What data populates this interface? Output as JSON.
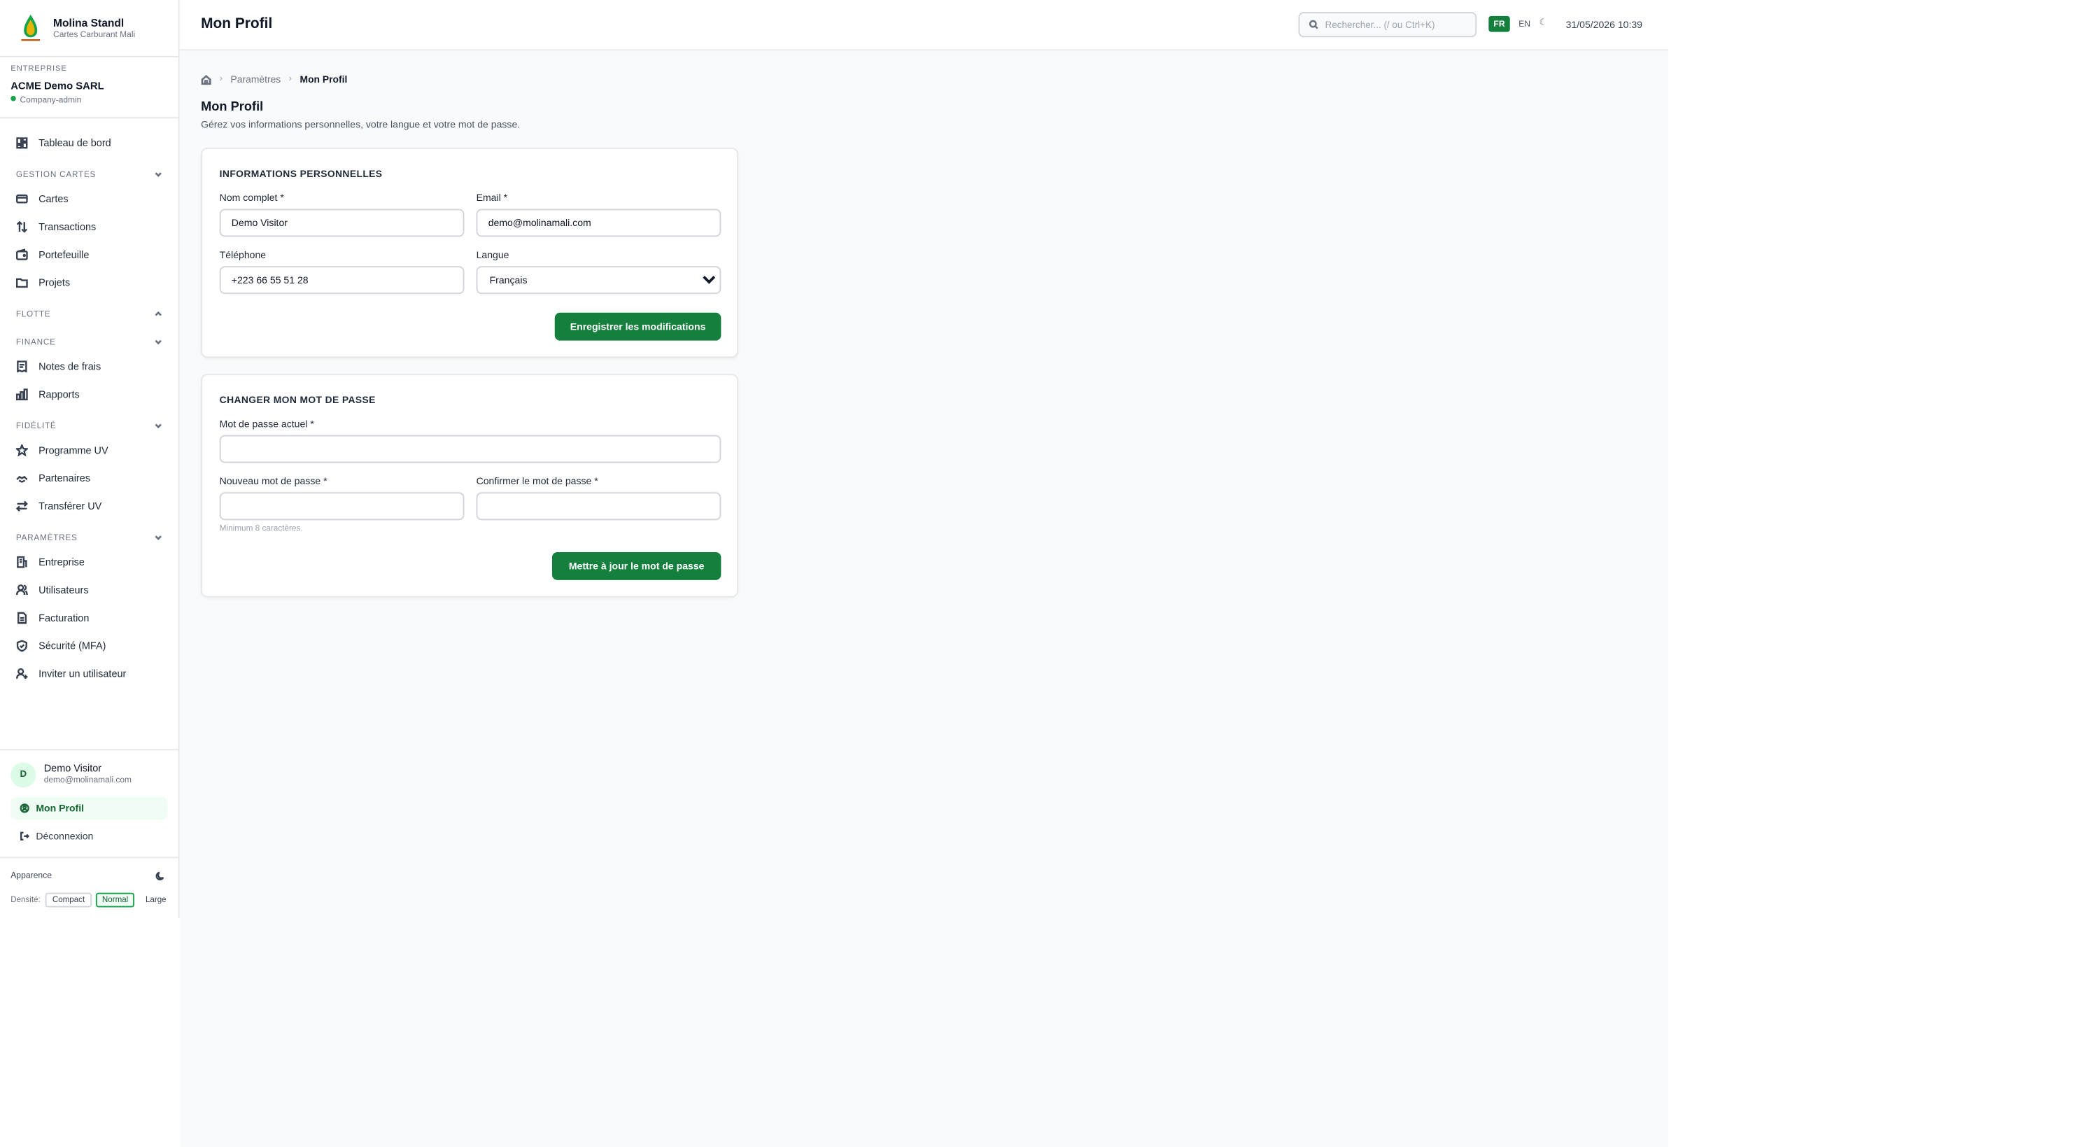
{
  "brand": {
    "name": "Molina Standl",
    "subtitle": "Cartes Carburant Mali"
  },
  "company": {
    "label": "ENTREPRISE",
    "name": "ACME Demo SARL",
    "role": "Company-admin"
  },
  "sidebar": {
    "dashboard": "Tableau de bord",
    "sections": {
      "cards": "GESTION CARTES",
      "fleet": "FLOTTE",
      "finance": "FINANCE",
      "loyalty": "FIDÉLITÉ",
      "settings": "PARAMÈTRES"
    },
    "items": {
      "cartes": "Cartes",
      "transactions": "Transactions",
      "portefeuille": "Portefeuille",
      "projets": "Projets",
      "notes": "Notes de frais",
      "rapports": "Rapports",
      "programme": "Programme UV",
      "partenaires": "Partenaires",
      "transferer": "Transférer UV",
      "entreprise": "Entreprise",
      "utilisateurs": "Utilisateurs",
      "facturation": "Facturation",
      "securite": "Sécurité (MFA)",
      "inviter": "Inviter un utilisateur"
    }
  },
  "user": {
    "initial": "D",
    "name": "Demo Visitor",
    "email": "demo@molinamali.com",
    "profile_link": "Mon Profil",
    "logout": "Déconnexion"
  },
  "appearance": {
    "label": "Apparence",
    "density_label": "Densité:",
    "density_options": [
      "Compact",
      "Normal",
      "Large"
    ],
    "density_selected": "Normal"
  },
  "topbar": {
    "title": "Mon Profil",
    "search_placeholder": "Rechercher... (/ ou Ctrl+K)",
    "lang_fr": "FR",
    "lang_en": "EN",
    "theme_glyph": "☾",
    "datetime": "31/05/2026 10:39"
  },
  "breadcrumb": {
    "parent": "Paramètres",
    "current": "Mon Profil"
  },
  "page": {
    "title": "Mon Profil",
    "subtitle": "Gérez vos informations personnelles, votre langue et votre mot de passe."
  },
  "profile_form": {
    "title": "INFORMATIONS PERSONNELLES",
    "name_label": "Nom complet *",
    "name_value": "Demo Visitor",
    "email_label": "Email *",
    "email_value": "demo@molinamali.com",
    "phone_label": "Téléphone",
    "phone_value": "+223 66 55 51 28",
    "language_label": "Langue",
    "language_value": "Français",
    "save_button": "Enregistrer les modifications"
  },
  "password_form": {
    "title": "CHANGER MON MOT DE PASSE",
    "current_label": "Mot de passe actuel *",
    "new_label": "Nouveau mot de passe *",
    "confirm_label": "Confirmer le mot de passe *",
    "hint": "Minimum 8 caractères.",
    "submit_button": "Mettre à jour le mot de passe"
  },
  "colors": {
    "accent": "#15803d",
    "accent_light": "#f0fdf4",
    "border": "#e5e7eb",
    "background": "#f9fafb"
  }
}
